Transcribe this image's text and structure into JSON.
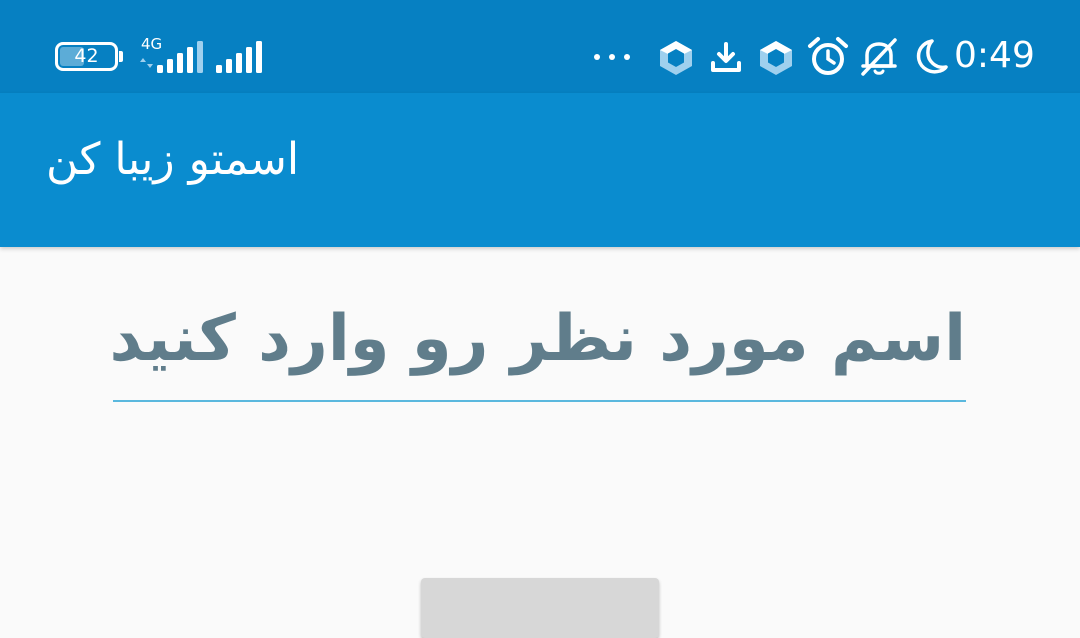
{
  "status_bar": {
    "battery_level": "42",
    "network_type": "4G",
    "time": "0:49",
    "overflow_indicator": "···",
    "icons": [
      "battery-icon",
      "signal-icon",
      "signal-icon",
      "more-notifications-icon",
      "app-notification-icon",
      "download-icon",
      "app-notification-icon",
      "alarm-icon",
      "notifications-off-icon",
      "do-not-disturb-moon-icon"
    ],
    "colors": {
      "background": "#0680c2"
    }
  },
  "app_bar": {
    "title": "اسمتو زیبا کن",
    "colors": {
      "background": "#0a8ccf",
      "text": "#ffffff"
    }
  },
  "form": {
    "name_placeholder": "اسم مورد نظر رو وارد کنید",
    "name_value": "",
    "colors": {
      "placeholder": "#607d8b",
      "underline": "#5ab8de"
    }
  },
  "action_button": {
    "label": "",
    "colors": {
      "background": "#d7d7d7"
    }
  }
}
